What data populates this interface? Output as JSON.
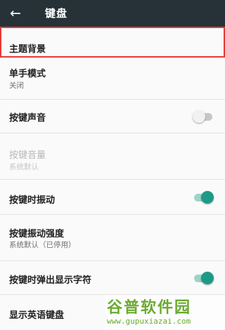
{
  "appbar": {
    "back_icon": "arrow-back-icon",
    "title": "键盘",
    "background": "#263238"
  },
  "settings": {
    "theme": {
      "label": "主题背景"
    },
    "one_hand": {
      "label": "单手模式",
      "value": "关闭"
    },
    "key_sound": {
      "label": "按键声音",
      "toggle": "off"
    },
    "key_volume": {
      "label": "按键音量",
      "value": "系统默认",
      "disabled": true
    },
    "key_vibration": {
      "label": "按键时振动",
      "toggle": "on"
    },
    "vibration_strength": {
      "label": "按键振动强度",
      "value": "系统默认（已停用）"
    },
    "key_popup": {
      "label": "按键时弹出显示字符",
      "toggle": "on"
    },
    "english_keyboard": {
      "label": "显示英语键盘"
    }
  },
  "accent_color": "#1e9a84",
  "highlight_color": "#e53935",
  "watermark": {
    "logo": "谷普软件园",
    "url": "www.gupuxiazai.com"
  }
}
